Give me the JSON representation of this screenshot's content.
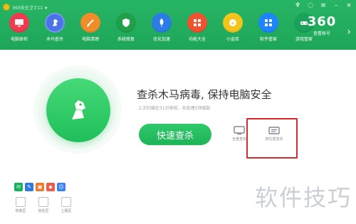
{
  "app": {
    "title": "360安全卫士11 ★",
    "brand_number": "360",
    "brand_sub": "查看帐号"
  },
  "nav": {
    "items": [
      {
        "label": "电脑体检",
        "icon": "monitor-icon",
        "color": "#ef3b4f"
      },
      {
        "label": "木马查杀",
        "icon": "horse-icon",
        "color": "#4b73e8"
      },
      {
        "label": "电脑清理",
        "icon": "broom-icon",
        "color": "#f08d2a"
      },
      {
        "label": "系统修复",
        "icon": "shield-icon",
        "color": "#20a049"
      },
      {
        "label": "优化加速",
        "icon": "rocket-icon",
        "color": "#2c7ce6"
      },
      {
        "label": "功能大全",
        "icon": "grid-icon",
        "color": "#f0522f"
      },
      {
        "label": "小金库",
        "icon": "coin-icon",
        "color": "#f3c51b"
      },
      {
        "label": "软件管家",
        "icon": "apps-icon",
        "color": "#1e85ff"
      },
      {
        "label": "游戏管家",
        "icon": "gamepad-icon",
        "color": "#1aa25b"
      }
    ]
  },
  "main": {
    "headline": "查杀木马病毒, 保持电脑安全",
    "subline": "上次扫描在31分钟前，共处理5项威胁",
    "quick_scan": "快速查杀",
    "tools": {
      "full_scan": "全盘查杀",
      "custom_scan": "按位置查杀"
    }
  },
  "bottom": {
    "tiny_icons": [
      {
        "icon": "mail-icon",
        "color": "#16b15d"
      },
      {
        "icon": "chat-icon",
        "color": "#2f79e0"
      },
      {
        "icon": "bag-icon",
        "color": "#f07a2c"
      },
      {
        "icon": "tag-icon",
        "color": "#f05a4a"
      },
      {
        "icon": "user-icon",
        "color": "#3b82f6"
      }
    ],
    "tools": [
      {
        "label": "恢复区",
        "icon": "recycle-icon"
      },
      {
        "label": "信任区",
        "icon": "shield-outline-icon"
      },
      {
        "label": "上报区",
        "icon": "upload-icon"
      }
    ]
  },
  "watermark": "软件技巧"
}
